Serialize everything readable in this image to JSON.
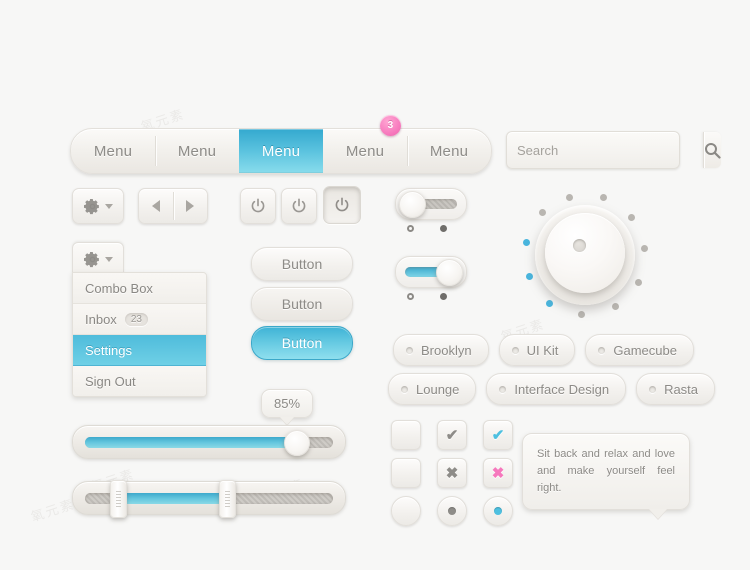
{
  "menubar": {
    "items": [
      {
        "label": "Menu",
        "state": "normal"
      },
      {
        "label": "Menu",
        "state": "normal"
      },
      {
        "label": "Menu",
        "state": "active"
      },
      {
        "label": "Menu",
        "state": "normal",
        "badge": "3"
      },
      {
        "label": "Menu",
        "state": "normal"
      }
    ]
  },
  "search": {
    "placeholder": "Search",
    "value": "",
    "icon": "search-icon"
  },
  "toolbar": {
    "gear_icon": "gear-icon",
    "caret_icon": "chevron-down-icon",
    "prev_icon": "triangle-left-icon",
    "next_icon": "triangle-right-icon",
    "power_icon": "power-icon",
    "power_buttons": [
      "normal",
      "normal",
      "pressed"
    ]
  },
  "dropdown": {
    "toggle_icon": "gear-icon",
    "items": [
      {
        "label": "Combo Box",
        "state": "normal"
      },
      {
        "label": "Inbox",
        "state": "normal",
        "count": "23"
      },
      {
        "label": "Settings",
        "state": "selected"
      },
      {
        "label": "Sign Out",
        "state": "normal"
      }
    ]
  },
  "buttons": [
    {
      "label": "Button",
      "style": "default"
    },
    {
      "label": "Button",
      "style": "hover"
    },
    {
      "label": "Button",
      "style": "primary"
    }
  ],
  "toggles": [
    {
      "state": "off",
      "left_dot": "hollow",
      "right_dot": "filled"
    },
    {
      "state": "on",
      "left_dot": "hollow",
      "right_dot": "filled"
    }
  ],
  "dial": {
    "name": "volume-knob",
    "total_dots": 11,
    "active_dots": 3,
    "active_color": "#49b5dd",
    "inactive_color": "#b9b6b1"
  },
  "tags": {
    "row1": [
      "Brooklyn",
      "UI Kit",
      "Gamecube"
    ],
    "row2": [
      "Lounge",
      "Interface Design",
      "Rasta"
    ]
  },
  "slider": {
    "value_label": "85%",
    "fill_percent": 85
  },
  "range_slider": {
    "start_percent": 13,
    "end_percent": 57
  },
  "checkbox_grid": {
    "rows": [
      [
        {
          "shape": "square",
          "glyph": "",
          "color": "none",
          "name": "checkbox-empty"
        },
        {
          "shape": "square",
          "glyph": "✔",
          "color": "gray",
          "name": "checkbox-checked-gray"
        },
        {
          "shape": "square",
          "glyph": "✔",
          "color": "blue",
          "name": "checkbox-checked-blue"
        }
      ],
      [
        {
          "shape": "square",
          "glyph": "",
          "color": "none",
          "name": "checkbox-empty"
        },
        {
          "shape": "square",
          "glyph": "✖",
          "color": "gray",
          "name": "checkbox-x-gray"
        },
        {
          "shape": "square",
          "glyph": "✖",
          "color": "pink",
          "name": "checkbox-x-pink"
        }
      ],
      [
        {
          "shape": "round",
          "glyph": "",
          "color": "none",
          "name": "radio-empty"
        },
        {
          "shape": "round",
          "glyph": "dot",
          "color": "gray",
          "name": "radio-selected-gray"
        },
        {
          "shape": "round",
          "glyph": "dot",
          "color": "blue",
          "name": "radio-selected-blue"
        }
      ]
    ]
  },
  "tooltip": {
    "text": "Sit back and relax and love and make yourself feel right."
  },
  "colors": {
    "background": "#f7f7f6",
    "accent_blue": "#4fbcdb",
    "accent_pink": "#f678bd",
    "text_gray": "#8d8b87"
  },
  "watermark": "氧元素"
}
